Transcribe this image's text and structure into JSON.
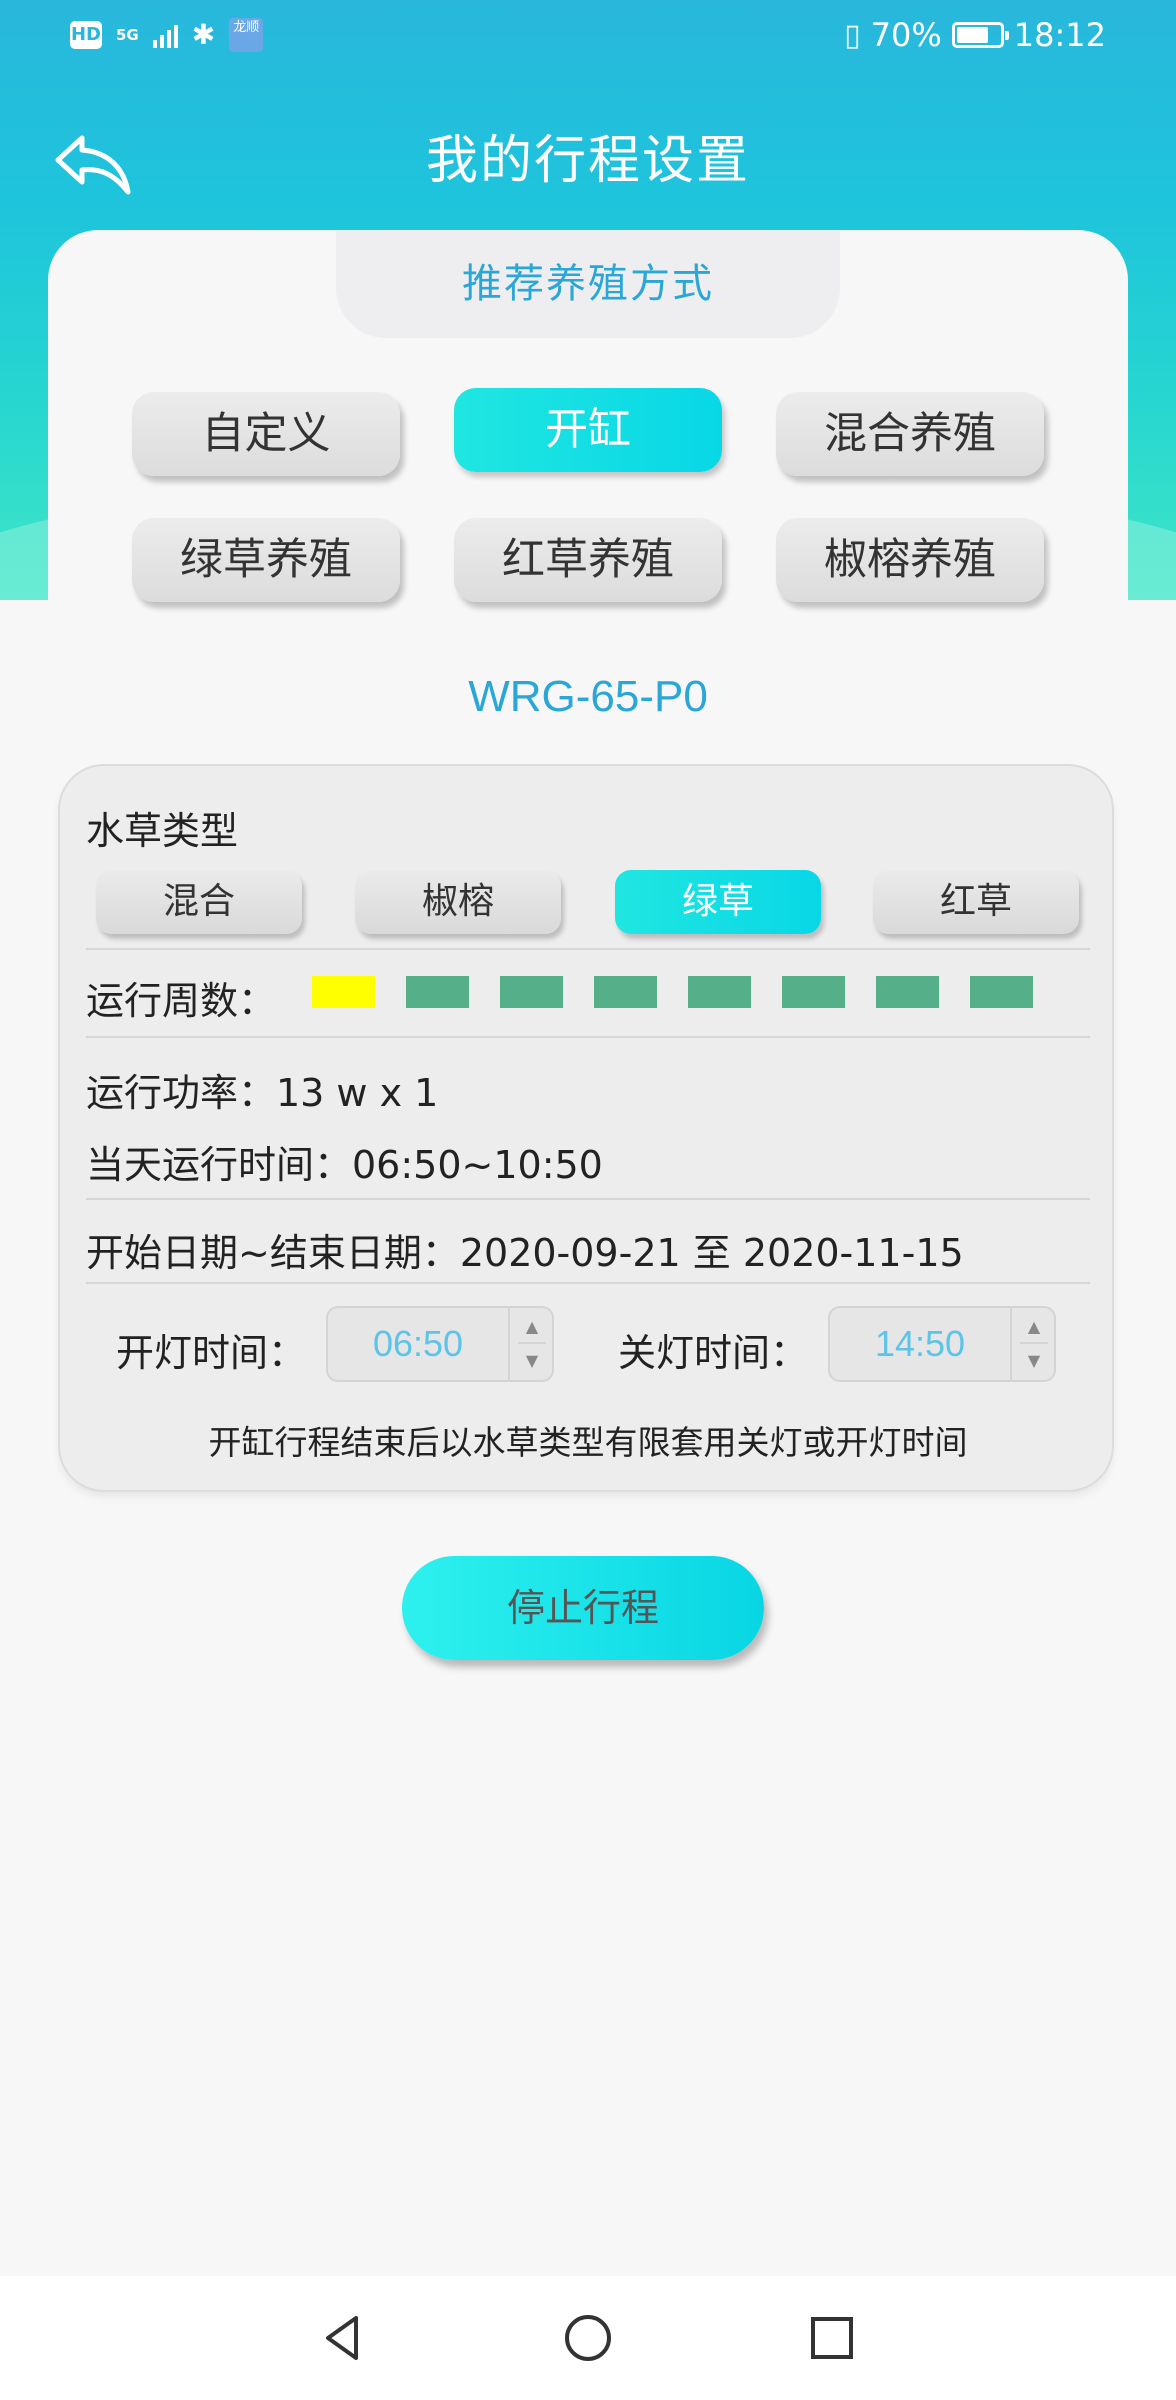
{
  "status_bar": {
    "hd": "HD",
    "network": "5G",
    "app_badge": "龙顺",
    "battery_pct": "70%",
    "battery_level": 0.7,
    "time": "18:12"
  },
  "header": {
    "title": "我的行程设置",
    "back_icon": "back-arrow-icon"
  },
  "recommend_tab": "推荐养殖方式",
  "modes": [
    {
      "label": "自定义",
      "active": false
    },
    {
      "label": "开缸",
      "active": true
    },
    {
      "label": "混合养殖",
      "active": false
    },
    {
      "label": "绿草养殖",
      "active": false
    },
    {
      "label": "红草养殖",
      "active": false
    },
    {
      "label": "椒榕养殖",
      "active": false
    }
  ],
  "model": "WRG-65-P0",
  "panel": {
    "plant_type_label": "水草类型",
    "plant_types": [
      {
        "label": "混合",
        "active": false
      },
      {
        "label": "椒榕",
        "active": false
      },
      {
        "label": "绿草",
        "active": true
      },
      {
        "label": "红草",
        "active": false
      }
    ],
    "weeks_label": "运行周数：",
    "weeks_total": 8,
    "weeks_current": 1,
    "power": "运行功率：13 w x 1",
    "daily_time": "当天运行时间：06:50~10:50",
    "date_range": "开始日期~结束日期：2020-09-21 至 2020-11-15",
    "light_on_label": "开灯时间：",
    "light_on_value": "06:50",
    "light_off_label": "关灯时间：",
    "light_off_value": "14:50",
    "note": "开缸行程结束后以水草类型有限套用关灯或开灯时间"
  },
  "stop_button": "停止行程",
  "colors": {
    "accent": "#08d7e6",
    "title_blue": "#2aa7d6",
    "week_done": "#55b08a",
    "week_current": "#ffff00"
  }
}
